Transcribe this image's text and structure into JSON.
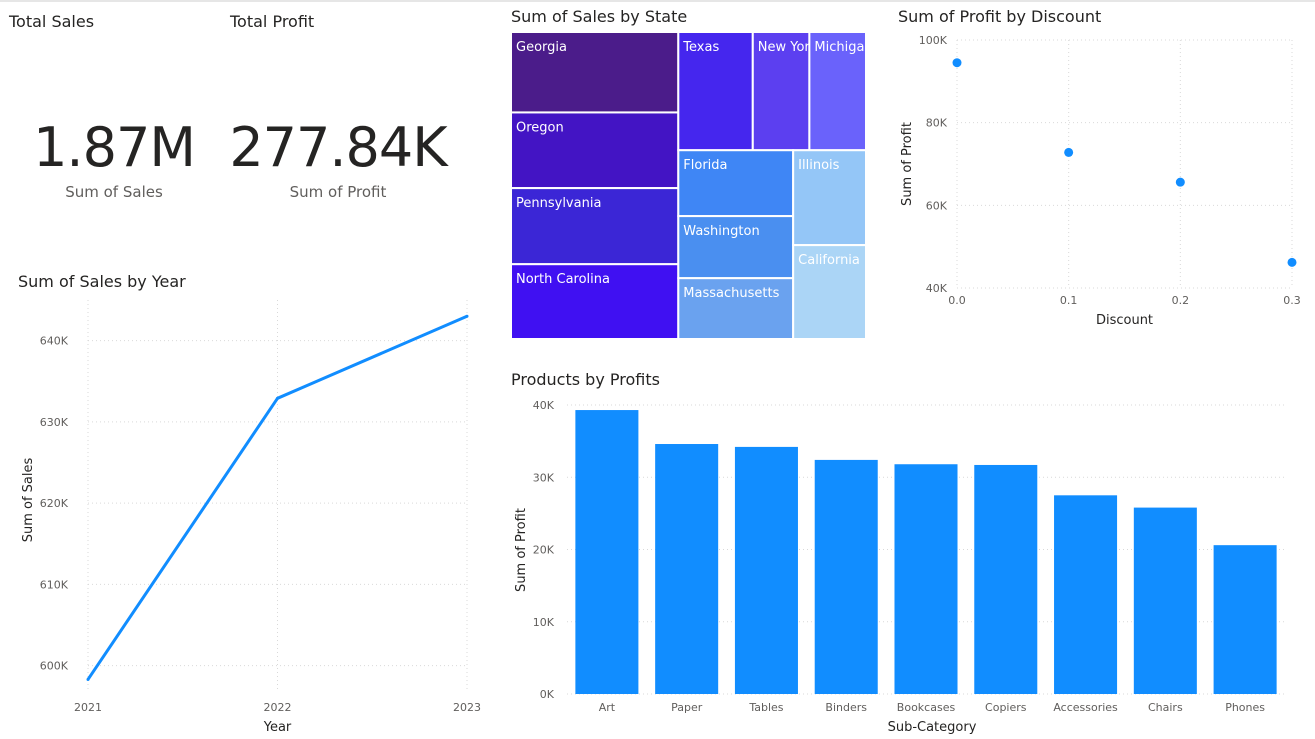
{
  "colors": {
    "accent": "#118dff",
    "treemap": [
      "#4b1c8a",
      "#4314c4",
      "#3b26d6",
      "#4010f2",
      "#4526ee",
      "#5c3ff0",
      "#6a62fb",
      "#3f86f5",
      "#4a8ff0",
      "#6aa2ef",
      "#94c6f7",
      "#abd5f6"
    ]
  },
  "kpis": [
    {
      "title": "Total Sales",
      "value": "1.87M",
      "label": "Sum of Sales"
    },
    {
      "title": "Total Profit",
      "value": "277.84K",
      "label": "Sum of Profit"
    }
  ],
  "chart_data": [
    {
      "id": "line",
      "type": "line",
      "title": "Sum of Sales by Year",
      "xlabel": "Year",
      "ylabel": "Sum of Sales",
      "categories": [
        "2021",
        "2022",
        "2023"
      ],
      "values": [
        598300,
        632900,
        643000
      ],
      "ylim": [
        597000,
        645000
      ],
      "yticks": [
        600000,
        610000,
        620000,
        630000,
        640000
      ],
      "ytick_labels": [
        "600K",
        "610K",
        "620K",
        "630K",
        "640K"
      ],
      "grid": true
    },
    {
      "id": "treemap",
      "type": "treemap",
      "title": "Sum of Sales by State",
      "categories": [
        "Georgia",
        "Oregon",
        "Pennsylvania",
        "North Carolina",
        "Texas",
        "New York",
        "Michigan",
        "Florida",
        "Washington",
        "Massachusetts",
        "Illinois",
        "California"
      ],
      "values": [
        185000,
        174000,
        175000,
        172000,
        121000,
        92000,
        92000,
        104000,
        98000,
        96000,
        95000,
        94000
      ]
    },
    {
      "id": "scatter",
      "type": "scatter",
      "title": "Sum of Profit by Discount",
      "xlabel": "Discount",
      "ylabel": "Sum of Profit",
      "points": [
        {
          "x": 0.0,
          "y": 94500
        },
        {
          "x": 0.1,
          "y": 72800
        },
        {
          "x": 0.2,
          "y": 65600
        },
        {
          "x": 0.3,
          "y": 46200
        }
      ],
      "xlim": [
        0,
        0.3
      ],
      "ylim": [
        40000,
        100000
      ],
      "xticks": [
        0,
        0.1,
        0.2,
        0.3
      ],
      "xtick_labels": [
        "0.0",
        "0.1",
        "0.2",
        "0.3"
      ],
      "yticks": [
        40000,
        60000,
        80000,
        100000
      ],
      "ytick_labels": [
        "40K",
        "60K",
        "80K",
        "100K"
      ],
      "grid": true
    },
    {
      "id": "bar",
      "type": "bar",
      "title": "Products by Profits",
      "xlabel": "Sub-Category",
      "ylabel": "Sum of Profit",
      "categories": [
        "Art",
        "Paper",
        "Tables",
        "Binders",
        "Bookcases",
        "Copiers",
        "Accessories",
        "Chairs",
        "Phones"
      ],
      "values": [
        39300,
        34600,
        34200,
        32400,
        31800,
        31700,
        27500,
        25800,
        20600
      ],
      "ylim": [
        0,
        40000
      ],
      "yticks": [
        0,
        10000,
        20000,
        30000,
        40000
      ],
      "ytick_labels": [
        "0K",
        "10K",
        "20K",
        "30K",
        "40K"
      ],
      "grid": true
    }
  ]
}
